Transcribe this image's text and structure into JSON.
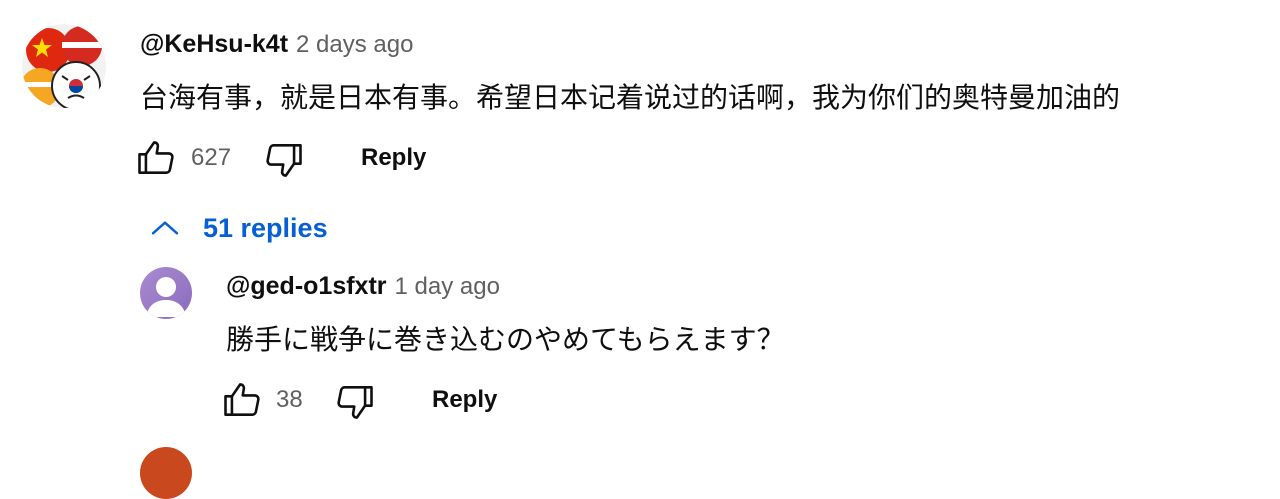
{
  "comment": {
    "author": "@KeHsu-k4t",
    "timestamp": "2 days ago",
    "text": "台海有事，就是日本有事。希望日本记着说过的话啊，我为你们的奥特曼加油的",
    "like_count": "627",
    "reply_label": "Reply",
    "like_icon": "thumbs-up-icon",
    "dislike_icon": "thumbs-down-icon"
  },
  "replies_toggle": {
    "label": "51 replies",
    "icon": "chevron-up-icon",
    "color": "#065fd4"
  },
  "reply": {
    "author": "@ged-o1sfxtr",
    "timestamp": "1 day ago",
    "text": "勝手に戦争に巻き込むのやめてもらえます？",
    "like_count": "38",
    "reply_label": "Reply",
    "avatar_color": "#9d7cc4"
  },
  "next_reply": {
    "avatar_color": "#c9481e"
  }
}
